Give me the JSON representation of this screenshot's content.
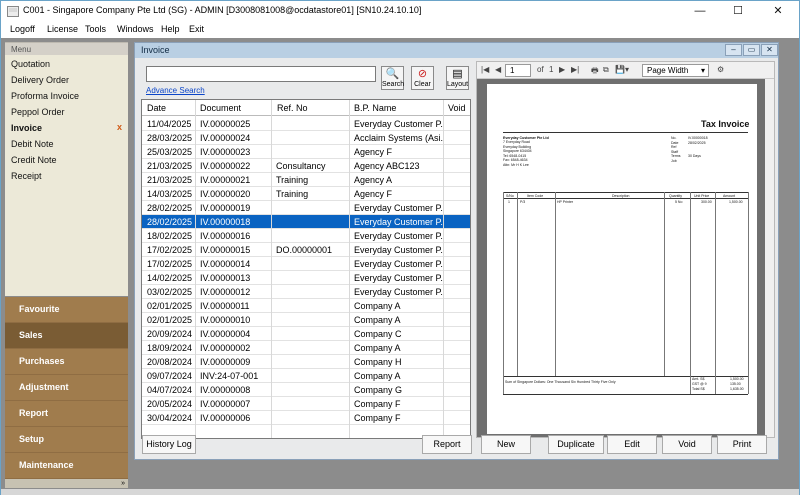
{
  "window": {
    "title": "C001 - Singapore Company Pte Ltd (SG) - ADMIN [D3008081008@ocdatastore01] [SN10.24.10.10]",
    "min": "—",
    "max": "☐",
    "close": "✕"
  },
  "menubar": [
    "Logoff",
    "License",
    "Tools",
    "Windows",
    "Help",
    "Exit"
  ],
  "sidebar": {
    "header": "Menu",
    "items": [
      {
        "label": "Quotation"
      },
      {
        "label": "Delivery Order"
      },
      {
        "label": "Proforma Invoice"
      },
      {
        "label": "Peppol Order"
      },
      {
        "label": "Invoice",
        "active": true,
        "close": "x"
      },
      {
        "label": "Debit Note"
      },
      {
        "label": "Credit Note"
      },
      {
        "label": "Receipt"
      }
    ],
    "groups": [
      "Favourite",
      "Sales",
      "Purchases",
      "Adjustment",
      "Report",
      "Setup",
      "Maintenance"
    ],
    "active_group": "Sales",
    "footer": "»"
  },
  "panel": {
    "title": "Invoice",
    "search_value": "",
    "advance_search": "Advance Search",
    "search_label": "Search",
    "clear_label": "Clear",
    "layout_label": "Layout"
  },
  "grid": {
    "columns": [
      "Date",
      "Document",
      "Ref. No",
      "B.P. Name",
      "Void"
    ],
    "rows": [
      [
        "11/04/2025",
        "IV.00000025",
        "",
        "Everyday Customer P..."
      ],
      [
        "28/03/2025",
        "IV.00000024",
        "",
        "Acclaim Systems (Asi..."
      ],
      [
        "25/03/2025",
        "IV.00000023",
        "",
        "Agency F"
      ],
      [
        "21/03/2025",
        "IV.00000022",
        "Consultancy",
        "Agency ABC123"
      ],
      [
        "21/03/2025",
        "IV.00000021",
        "Training",
        "Agency A"
      ],
      [
        "14/03/2025",
        "IV.00000020",
        "Training",
        "Agency F"
      ],
      [
        "28/02/2025",
        "IV.00000019",
        "",
        "Everyday Customer P..."
      ],
      [
        "28/02/2025",
        "IV.00000018",
        "",
        "Everyday Customer P..."
      ],
      [
        "18/02/2025",
        "IV.00000016",
        "",
        "Everyday Customer P..."
      ],
      [
        "17/02/2025",
        "IV.00000015",
        "DO.00000001",
        "Everyday Customer P..."
      ],
      [
        "17/02/2025",
        "IV.00000014",
        "",
        "Everyday Customer P..."
      ],
      [
        "14/02/2025",
        "IV.00000013",
        "",
        "Everyday Customer P..."
      ],
      [
        "03/02/2025",
        "IV.00000012",
        "",
        "Everyday Customer P..."
      ],
      [
        "02/01/2025",
        "IV.00000011",
        "",
        "Company A"
      ],
      [
        "02/01/2025",
        "IV.00000010",
        "",
        "Company A"
      ],
      [
        "20/09/2024",
        "IV.00000004",
        "",
        "Company C"
      ],
      [
        "18/09/2024",
        "IV.00000002",
        "",
        "Company A"
      ],
      [
        "20/08/2024",
        "IV.00000009",
        "",
        "Company H"
      ],
      [
        "09/07/2024",
        "INV:24-07-001",
        "",
        "Company A"
      ],
      [
        "04/07/2024",
        "IV.00000008",
        "",
        "Company G"
      ],
      [
        "20/05/2024",
        "IV.00000007",
        "",
        "Company F"
      ],
      [
        "30/04/2024",
        "IV.00000006",
        "",
        "Company F"
      ]
    ],
    "selected_index": 7
  },
  "preview": {
    "page": "1",
    "of_label": "of",
    "total_pages": "1",
    "zoom": "Page Width",
    "doc": {
      "title": "Tax Invoice",
      "company": "Everyday Customer Pte Ltd",
      "lines": [
        "7 Everyday Road",
        "Everyday Building",
        "Singapore 634404",
        "Tel: 6548-0415",
        "Fax: 6548-4634",
        "Attn: Mr H K Lee"
      ],
      "meta": [
        "IV.00000018",
        "28/02/2025",
        "",
        "",
        "30 Days",
        ""
      ],
      "meta_labels": [
        "No.",
        "Date",
        "Ref",
        "Staff",
        "Terms",
        "Job"
      ],
      "table_headers": [
        "S/No",
        "Item Code",
        "Description",
        "Quantity",
        "Unit Price",
        "Amount"
      ],
      "item": [
        "1",
        "P/3",
        "HP Printer",
        "5 No",
        "300.00",
        "1,500.00"
      ],
      "words": "Sum of Singapore Dollars: One Thousand Six Hundred Thirty Five Only",
      "total_labels": [
        "Amt. S$",
        "GST @ 9",
        "Total S$"
      ],
      "total_values": [
        "1,500.00",
        "135.00",
        "1,635.00"
      ]
    }
  },
  "buttons": {
    "history": "History Log",
    "report": "Report",
    "new": "New",
    "duplicate": "Duplicate",
    "edit": "Edit",
    "void": "Void",
    "print": "Print"
  }
}
